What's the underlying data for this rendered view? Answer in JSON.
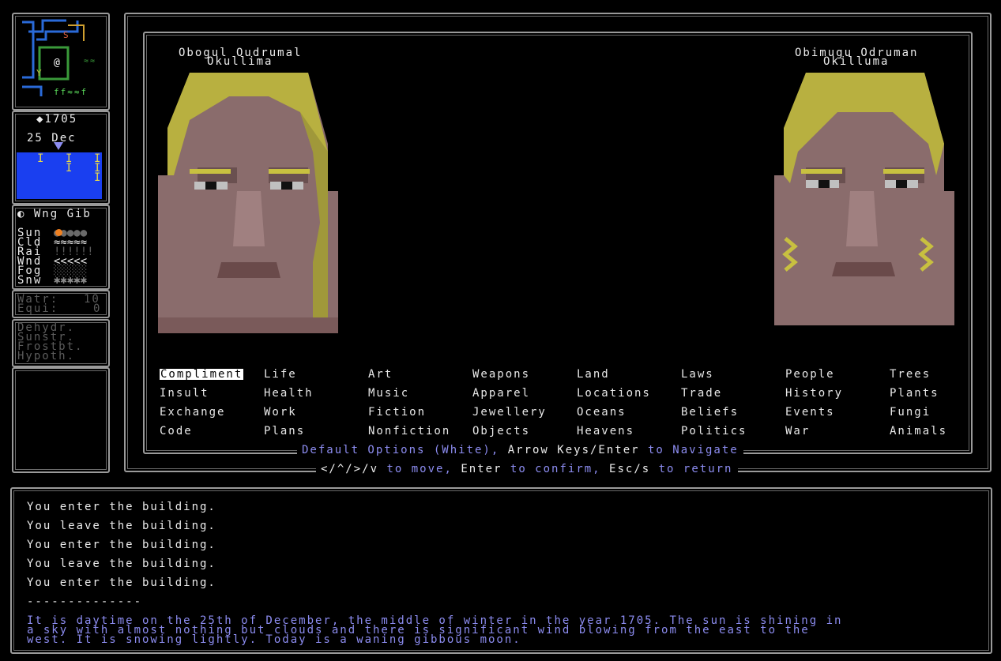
{
  "sidebar": {
    "year": "◆1705",
    "date": "25 Dec",
    "moon_line": "◐ Wng Gib",
    "weather_labels": [
      "Sun",
      "Cld",
      "Rai",
      "Wnd",
      "Fog",
      "Snw"
    ],
    "weather_values": [
      "●●●●●",
      "≈≈≈≈≈",
      "!!!!!!",
      "<<<<<",
      "░░░░░",
      "✱✱✱✱✱"
    ],
    "stats": [
      {
        "label": "Watr:",
        "value": "10"
      },
      {
        "label": "Equi:",
        "value": "0"
      }
    ],
    "conditions": [
      "Dehydr.",
      "Sunstr.",
      "Frostbt.",
      "Hypoth."
    ],
    "sky_marks": [
      "I",
      "I",
      "I",
      "I",
      "I",
      "I"
    ]
  },
  "dialogue": {
    "left_name_1": "Obogul Oudrumal",
    "left_name_2": "Okullima",
    "right_name_1": "Obimugu Odruman",
    "right_name_2": "Okilluma",
    "menu": [
      [
        "Compliment",
        "Life",
        "Art",
        "Weapons",
        "Land",
        "Laws",
        "People",
        "Trees"
      ],
      [
        "Insult",
        "Health",
        "Music",
        "Apparel",
        "Locations",
        "Trade",
        "History",
        "Plants"
      ],
      [
        "Exchange",
        "Work",
        "Fiction",
        "Jewellery",
        "Oceans",
        "Beliefs",
        "Events",
        "Fungi"
      ],
      [
        "Code",
        "Plans",
        "Nonfiction",
        "Objects",
        "Heavens",
        "Politics",
        "War",
        "Animals"
      ]
    ],
    "selected": "Compliment",
    "hint1_a": "Default Options (White), ",
    "hint1_b": "Arrow Keys/Enter",
    "hint1_c": " to Navigate",
    "hint2_a": "</^/>/v",
    "hint2_b": " to move, ",
    "hint2_c": "Enter",
    "hint2_d": " to confirm, ",
    "hint2_e": "Esc/s",
    "hint2_f": " to return"
  },
  "log": {
    "lines": [
      "You enter the building.",
      "You leave the building.",
      "You enter the building.",
      "You leave the building.",
      "You enter the building."
    ],
    "separator": "--------------",
    "description": [
      "It is daytime on the 25th of December, the middle of winter in the year 1705. The sun is shining in",
      "a sky with almost nothing but clouds and there is significant wind blowing from the east to the",
      "west. It is snowing lightly. Today is a waning gibbous moon."
    ]
  },
  "colors": {
    "frame": "#9a9a9a",
    "hint": "#8c8cf0",
    "sky": "#1a3ff0",
    "hair": "#b8b040",
    "skin": "#8a6a6a"
  }
}
